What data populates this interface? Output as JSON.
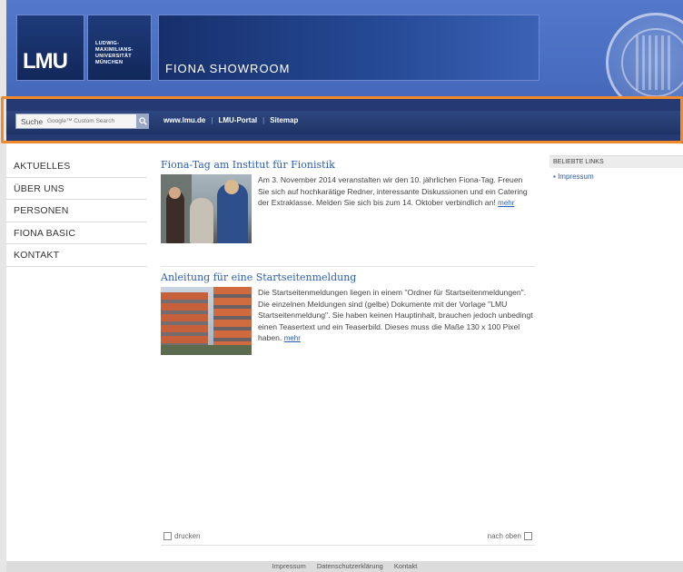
{
  "header": {
    "logo": "LMU",
    "university_name": [
      "LUDWIG-",
      "MAXIMILIANS-",
      "UNIVERSITÄT",
      "MÜNCHEN"
    ],
    "site_title": "FIONA SHOWROOM"
  },
  "toolbar": {
    "search_label": "Suche",
    "search_placeholder": "Google™ Custom Search",
    "links": [
      "www.lmu.de",
      "LMU-Portal",
      "Sitemap"
    ]
  },
  "sidenav": {
    "items": [
      "AKTUELLES",
      "ÜBER UNS",
      "PERSONEN",
      "FIONA BASIC",
      "KONTAKT"
    ]
  },
  "articles": [
    {
      "title": "Fiona-Tag am Institut für Fionistik",
      "text": "Am 3. November 2014 veranstalten wir den 10. jährlichen Fiona-Tag. Freuen Sie sich auf hochkarätige Redner, interessante Diskussionen und ein Catering der Extraklasse. Melden Sie sich bis zum 14. Oktober verbindlich an!",
      "more": "mehr"
    },
    {
      "title": "Anleitung für eine Startseitenmeldung",
      "text": "Die Startseitenmeldungen liegen in einem \"Ordner für Startseitenmeldungen\". Die einzelnen Meldungen sind (gelbe) Dokumente mit der Vorlage \"LMU Startseitenmeldung\". Sie haben keinen Hauptinhalt, brauchen jedoch unbedingt einen Teasertext und ein Teaserbild. Dieses muss die Maße 130 x 100 Pixel haben.",
      "more": "mehr"
    }
  ],
  "sidebar_right": {
    "heading": "BELIEBTE LINKS",
    "links": [
      "Impressum"
    ]
  },
  "page_footer": {
    "print": "drucken",
    "to_top": "nach oben"
  },
  "footer": {
    "links": [
      "Impressum",
      "Datenschutzerklärung",
      "Kontakt"
    ]
  },
  "colors": {
    "header_blue": "#4a70c3",
    "toolbar_dark": "#253a72",
    "link_blue": "#2a5db0",
    "highlight_orange": "#f08a2a"
  }
}
